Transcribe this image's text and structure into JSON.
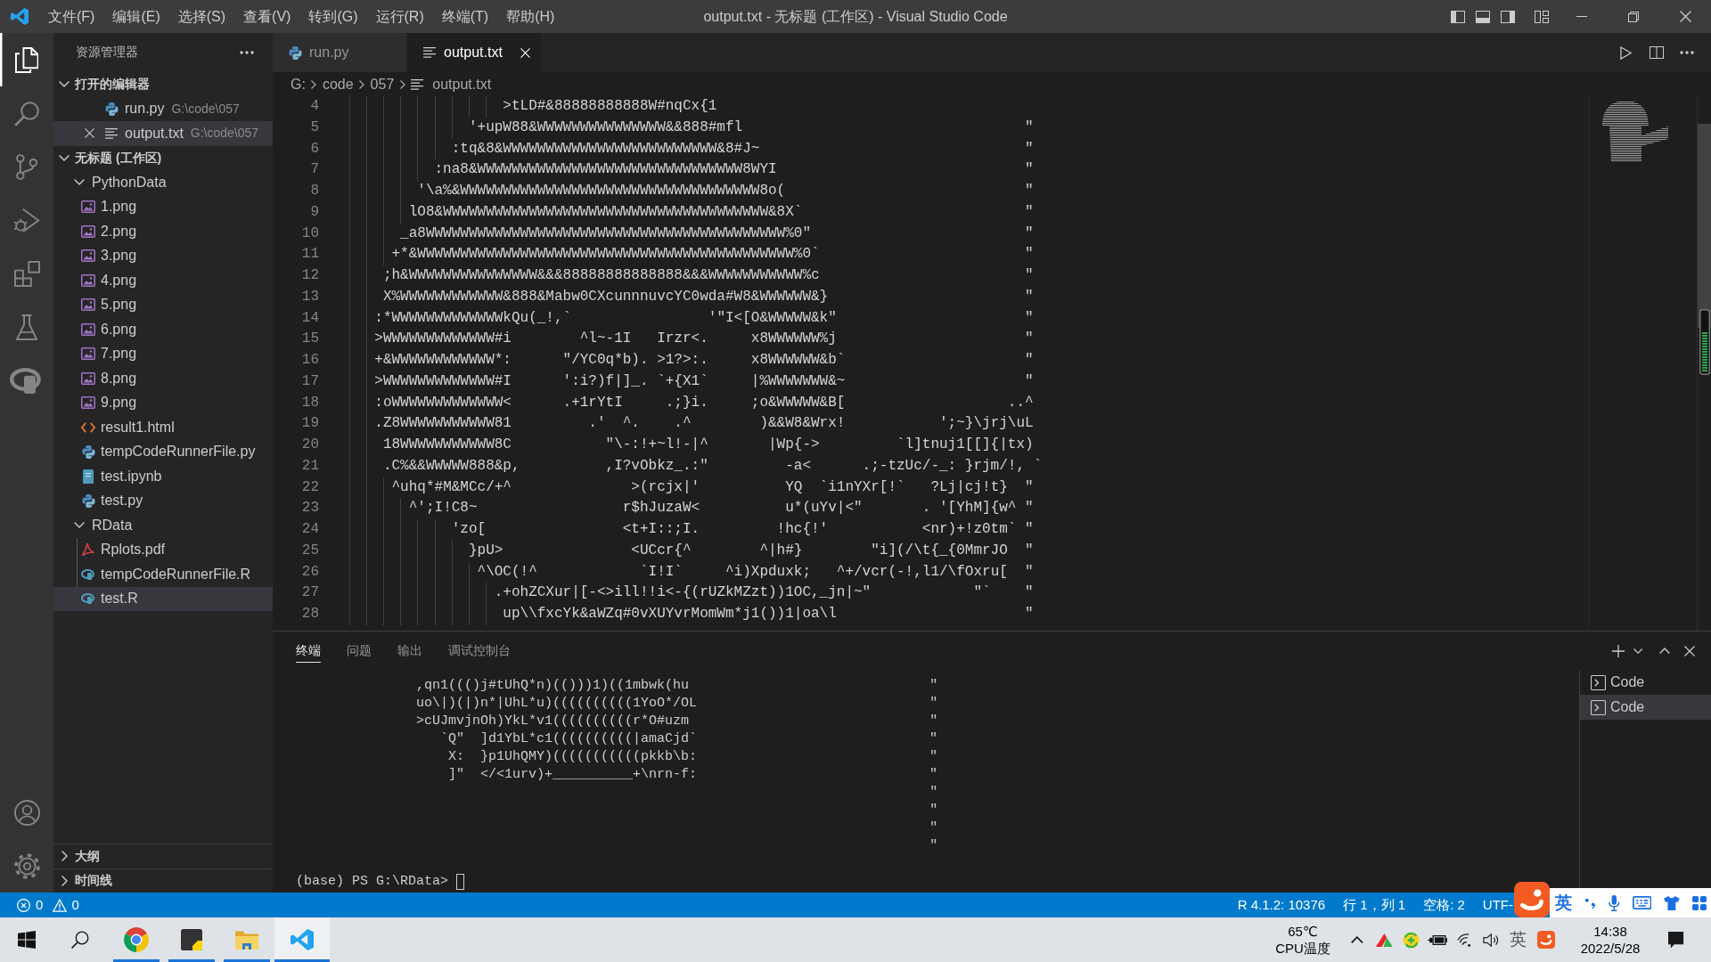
{
  "title_bar": {
    "menu": [
      "文件(F)",
      "编辑(E)",
      "选择(S)",
      "查看(V)",
      "转到(G)",
      "运行(R)",
      "终端(T)",
      "帮助(H)"
    ],
    "title": "output.txt - 无标题 (工作区) - Visual Studio Code"
  },
  "activity_bar": {
    "items": [
      {
        "kind": "explorer",
        "selected": true
      },
      {
        "kind": "search",
        "selected": false
      },
      {
        "kind": "source_control",
        "selected": false
      },
      {
        "kind": "debug",
        "selected": false
      },
      {
        "kind": "extensions",
        "selected": false
      },
      {
        "kind": "testing",
        "selected": false
      },
      {
        "kind": "r",
        "selected": false
      }
    ],
    "bottom": [
      {
        "kind": "account"
      },
      {
        "kind": "settings"
      }
    ]
  },
  "sidebar": {
    "title": "资源管理器",
    "open_editors": {
      "title": "打开的编辑器",
      "expanded": true,
      "items": [
        {
          "kind": "python",
          "label": "run.py",
          "path": "G:\\code\\057",
          "selected": false
        },
        {
          "kind": "text",
          "label": "output.txt",
          "path": "G:\\code\\057",
          "selected": true
        }
      ]
    },
    "workspace": {
      "title": "无标题 (工作区)",
      "expanded": true,
      "children": [
        {
          "kind": "folder",
          "label": "PythonData",
          "expanded": true,
          "selected": false,
          "children": [
            {
              "kind": "image",
              "label": "1.png",
              "selected": false
            },
            {
              "kind": "image",
              "label": "2.png",
              "selected": false
            },
            {
              "kind": "image",
              "label": "3.png",
              "selected": false
            },
            {
              "kind": "image",
              "label": "4.png",
              "selected": false
            },
            {
              "kind": "image",
              "label": "5.png",
              "selected": false
            },
            {
              "kind": "image",
              "label": "6.png",
              "selected": false
            },
            {
              "kind": "image",
              "label": "7.png",
              "selected": false
            },
            {
              "kind": "image",
              "label": "8.png",
              "selected": false
            },
            {
              "kind": "image",
              "label": "9.png",
              "selected": false
            },
            {
              "kind": "html",
              "label": "result1.html",
              "selected": false
            },
            {
              "kind": "python",
              "label": "tempCodeRunnerFile.py",
              "selected": false
            },
            {
              "kind": "notebook",
              "label": "test.ipynb",
              "selected": false
            },
            {
              "kind": "python",
              "label": "test.py",
              "selected": false
            }
          ]
        },
        {
          "kind": "folder",
          "label": "RData",
          "expanded": true,
          "selected": false,
          "children": [
            {
              "kind": "pdf",
              "label": "Rplots.pdf",
              "selected": false
            },
            {
              "kind": "r",
              "label": "tempCodeRunnerFile.R",
              "selected": false
            },
            {
              "kind": "r",
              "label": "test.R",
              "selected": true
            }
          ]
        }
      ]
    },
    "outline": {
      "title": "大纲",
      "expanded": false
    },
    "timeline": {
      "title": "时间线",
      "expanded": false
    }
  },
  "editor": {
    "tabs": [
      {
        "kind": "python",
        "label": "run.py",
        "selected": false
      },
      {
        "kind": "text",
        "label": "output.txt",
        "selected": true
      }
    ],
    "breadcrumbs": [
      "G:",
      "code",
      "057",
      "output.txt"
    ],
    "lines": [
      {
        "number": "4",
        "text": "                  >tLD#&88888888888W#nqCx{1"
      },
      {
        "number": "5",
        "text": "              '+upW88&WWWWWWWWWWWWWWW&&888#mfl                                 \""
      },
      {
        "number": "6",
        "text": "            :tq&8&WWWWWWWWWWWWWWWWWWWWWWWWW&8#J~                               \""
      },
      {
        "number": "7",
        "text": "          :na8&WWWWWWWWWWWWWWWWWWWWWWWWWWWWWWW8WYI                             \""
      },
      {
        "number": "8",
        "text": "        '\\a%&WWWWWWWWWWWWWWWWWWWWWWWWWWWWWWWWWWW8o(                            \""
      },
      {
        "number": "9",
        "text": "       lO8&WWWWWWWWWWWWWWWWWWWWWWWWWWWWWWWWWWWWWW&8X`                          \""
      },
      {
        "number": "10",
        "text": "      _a8WWWWWWWWWWWWWWWWWWWWWWWWWWWWWWWWWWWWWWWWWW%0\"                         \""
      },
      {
        "number": "11",
        "text": "     +*&WWWWWWWWWWWWWWWWWWWWWWWWWWWWWWWWWWWWWWWWWWWW%0`                        \""
      },
      {
        "number": "12",
        "text": "    ;h&WWWWWWWWWWWWWWW&&&88888888888888&&&WWWWWWWWWWW%c                        \""
      },
      {
        "number": "13",
        "text": "    X%WWWWWWWWWWWW&888&Mabw0CXcunnnuvcYC0wda#W8&WWWWWW&}                       \""
      },
      {
        "number": "14",
        "text": "   :*WWWWWWWWWWWWWkQu(_!,`                '\"I<[O&WWWWW&k\"                      \""
      },
      {
        "number": "15",
        "text": "   >WWWWWWWWWWWWW#i        ^l~-1I   Irzr<.     x8WWWWWW%j                      \""
      },
      {
        "number": "16",
        "text": "   +&WWWWWWWWWWWW*:      \"/YC0q*b). >1?>:.     x8WWWWWW&b`                     \""
      },
      {
        "number": "17",
        "text": "   >WWWWWWWWWWWWW#I      ':i?)f|]_. `+{X1`     |%WWWWWWW&~                     \""
      },
      {
        "number": "18",
        "text": "   :oWWWWWWWWWWWWW<      .+1rYtI     .;}i.     ;o&WWWWW&B[                   ..^"
      },
      {
        "number": "19",
        "text": "   .Z8WWWWWWWWWWW81         .'  ^.    .^        )&&W8&Wrx!           ';~}\\jrj\\uL"
      },
      {
        "number": "20",
        "text": "    18WWWWWWWWWWW8C           \"\\-:!+~l!-|^       |Wp{->         `l]tnuj1[[]{|tx)"
      },
      {
        "number": "21",
        "text": "    .C%&&WWWWW888&p,          ,I?vObkz_.:\"         -a<      .;-tzUc/-_: }rjm/!, `"
      },
      {
        "number": "22",
        "text": "     ^uhq*#M&MCc/+^              >(rcjx|'          YQ  `i1nYXr[!`   ?Lj|cj!t}  \""
      },
      {
        "number": "23",
        "text": "       ^';I!C8~                 r$hJuzaW<          u*(uYv|<\"       . '[YhM]{w^ \""
      },
      {
        "number": "24",
        "text": "            'zo[                <t+I::;I.         !hc{!'           <nr)+!z0tm` \""
      },
      {
        "number": "25",
        "text": "              }pU>               <UCcr{^        ^|h#}        \"i](/\\t{_{0MmrJO  \""
      },
      {
        "number": "26",
        "text": "               ^\\OC(!^            `I!I`     ^i)Xpduxk;   ^+/vcr(-!,l1/\\fOxru[  \""
      },
      {
        "number": "27",
        "text": "                 .+ohZCXur|[-<>ill!!i<-{(rUZkMZzt))1OC,_jn|~\"            \"`    \""
      },
      {
        "number": "28",
        "text": "                  up\\\\fxcYk&aWZq#0vXUYvrMomWm*j1())1|oa\\l                      \""
      }
    ]
  },
  "panel": {
    "tabs": [
      {
        "label": "终端",
        "selected": true
      },
      {
        "label": "问题",
        "selected": false
      },
      {
        "label": "输出",
        "selected": false
      },
      {
        "label": "调试控制台",
        "selected": false
      }
    ],
    "terminal_lines": [
      "               ,qn1((()j#tUhQ*n)(()))1)((1mbwk(hu                              \"",
      "               uo\\|)(|)n*|UhL*u)((((((((((1YoO*/OL                             \"",
      "               >cUJmvjnOh)YkL*v1((((((((((r*O#uzm                              \"",
      "                  `Q\"  ]d1YbL*c1((((((((((|amaCjd`                             \"",
      "                   X:  }p1UhQMY)(((((((((((pkkb\\b:                             \"",
      "                   ]\"  </<1urv)+__________+\\nrn-f:                             \"",
      "                                                                               \"",
      "                                                                               \"",
      "                                                                               \"",
      "                                                                               \""
    ],
    "prompt": "(base) PS G:\\RData>",
    "terminals": [
      {
        "label": "Code",
        "selected": false
      },
      {
        "label": "Code",
        "selected": true
      }
    ]
  },
  "status_bar": {
    "errors": "0",
    "warnings": "0",
    "items": [
      "R 4.1.2: 10376",
      "行 1，列 1",
      "空格: 2",
      "UTF-"
    ]
  },
  "ime_toolbar": {
    "mode": "英"
  },
  "taskbar": {
    "apps": [
      {
        "kind": "chrome",
        "running": true,
        "selected": false
      },
      {
        "kind": "notes",
        "running": true,
        "selected": false
      },
      {
        "kind": "folder",
        "running": true,
        "selected": false
      },
      {
        "kind": "vscode",
        "running": true,
        "selected": true
      }
    ],
    "tray": {
      "temperature": "65℃",
      "temperature_label": "CPU温度",
      "language": "英",
      "time": "14:38",
      "date": "2022/5/28"
    }
  }
}
